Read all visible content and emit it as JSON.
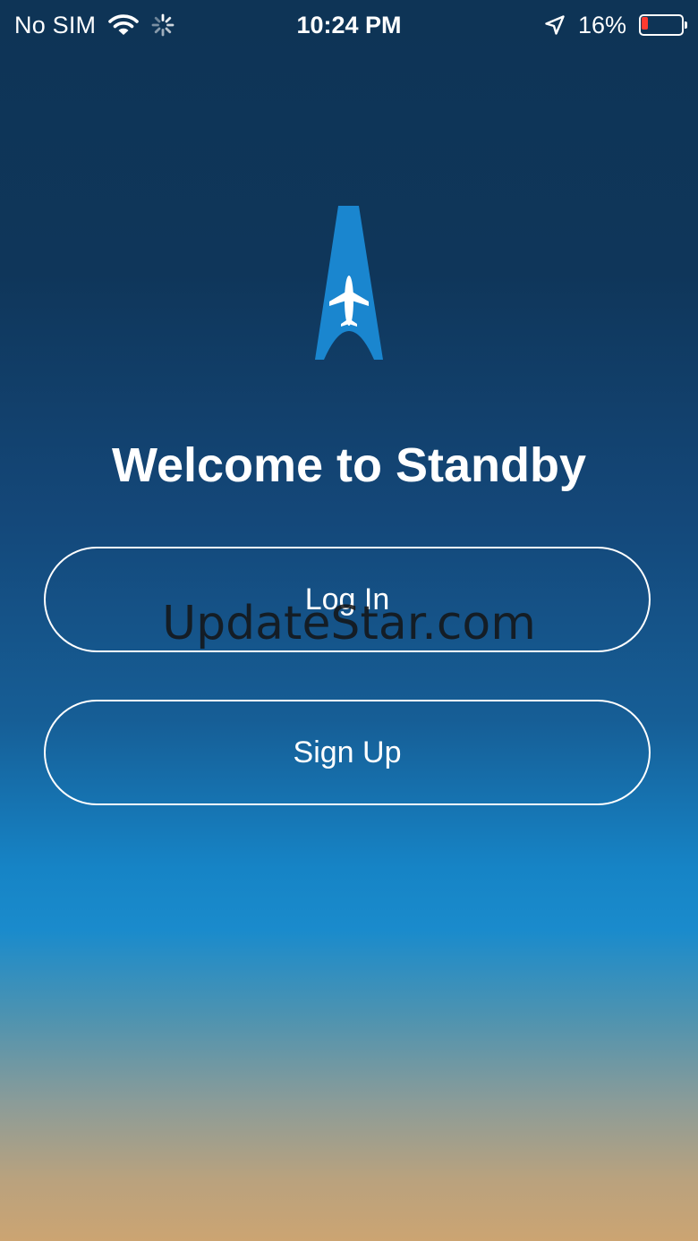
{
  "status_bar": {
    "carrier": "No SIM",
    "time": "10:24 PM",
    "battery_percent": "16%",
    "battery_level": 0.16,
    "battery_color": "#ff3b30",
    "icons": [
      "wifi-icon",
      "activity-spinner-icon",
      "location-arrow-icon",
      "battery-icon"
    ]
  },
  "logo": {
    "icon": "airplane-runway-logo",
    "color": "#1a86cf"
  },
  "welcome": {
    "title": "Welcome to Standby"
  },
  "buttons": {
    "login_label": "Log In",
    "signup_label": "Sign Up"
  },
  "watermark": {
    "text": "UpdateStar.com"
  }
}
